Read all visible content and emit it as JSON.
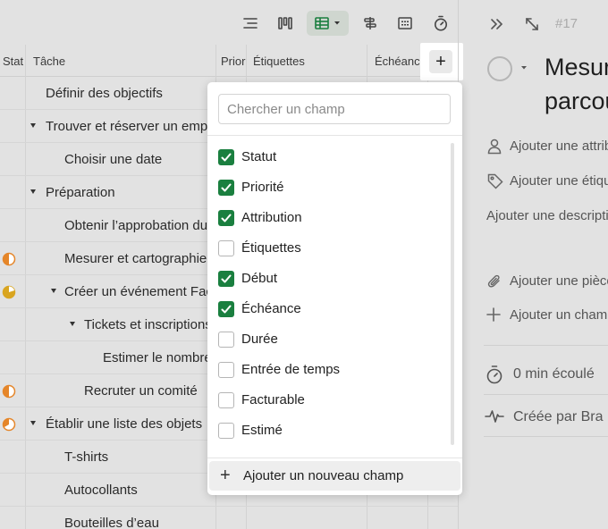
{
  "toolbar": {
    "icons": [
      "list-icon",
      "board-icon",
      "table-icon",
      "gantt-icon",
      "calendar-icon",
      "timer-icon"
    ]
  },
  "grid": {
    "columns": [
      "Stat",
      "Tâche",
      "Prior",
      "Étiquettes",
      "Échéance"
    ],
    "rows": [
      {
        "task": "Définir des objectifs",
        "caret": false,
        "status": null
      },
      {
        "task": "Trouver et réserver un emplacement",
        "caret": true,
        "status": null
      },
      {
        "task": "Choisir une date",
        "caret": false,
        "status": null
      },
      {
        "task": "Préparation",
        "caret": true,
        "status": null
      },
      {
        "task": "Obtenir l’approbation du",
        "caret": false,
        "status": null
      },
      {
        "task": "Mesurer et cartographier",
        "caret": false,
        "status": "half"
      },
      {
        "task": "Créer un événement Facebook",
        "caret": true,
        "status": "mostly"
      },
      {
        "task": "Tickets et inscriptions",
        "caret": true,
        "status": null
      },
      {
        "task": "Estimer le nombre",
        "caret": false,
        "status": null
      },
      {
        "task": "Recruter un comité",
        "caret": false,
        "status": "half"
      },
      {
        "task": "Établir une liste des objets",
        "caret": true,
        "status": "third"
      },
      {
        "task": "T-shirts",
        "caret": false,
        "status": null
      },
      {
        "task": "Autocollants",
        "caret": false,
        "status": null
      },
      {
        "task": "Bouteilles d’eau",
        "caret": false,
        "status": null
      }
    ]
  },
  "add_column_button": {
    "label": "+"
  },
  "field_menu": {
    "search_placeholder": "Chercher un champ",
    "fields": [
      {
        "label": "Statut",
        "checked": true
      },
      {
        "label": "Priorité",
        "checked": true
      },
      {
        "label": "Attribution",
        "checked": true
      },
      {
        "label": "Étiquettes",
        "checked": false
      },
      {
        "label": "Début",
        "checked": true
      },
      {
        "label": "Échéance",
        "checked": true
      },
      {
        "label": "Durée",
        "checked": false
      },
      {
        "label": "Entrée de temps",
        "checked": false
      },
      {
        "label": "Facturable",
        "checked": false
      },
      {
        "label": "Estimé",
        "checked": false
      }
    ],
    "add_new_label": "Ajouter un nouveau champ"
  },
  "task_panel": {
    "task_id": "#17",
    "title_line1": "Mesurer",
    "title_line2": "parcou",
    "assignee_placeholder": "Ajouter une attribution",
    "tags_placeholder": "Ajouter une étiquette",
    "description_placeholder": "Ajouter une description",
    "attachment_placeholder": "Ajouter une pièce jointe",
    "add_field_placeholder": "Ajouter un champ",
    "time_tracked": "0 min écoulé",
    "created_by": "Créée par Bra"
  },
  "colors": {
    "accent_green": "#1a7f3f",
    "status_orange": "#e5862a",
    "status_yellow": "#d9a520"
  }
}
